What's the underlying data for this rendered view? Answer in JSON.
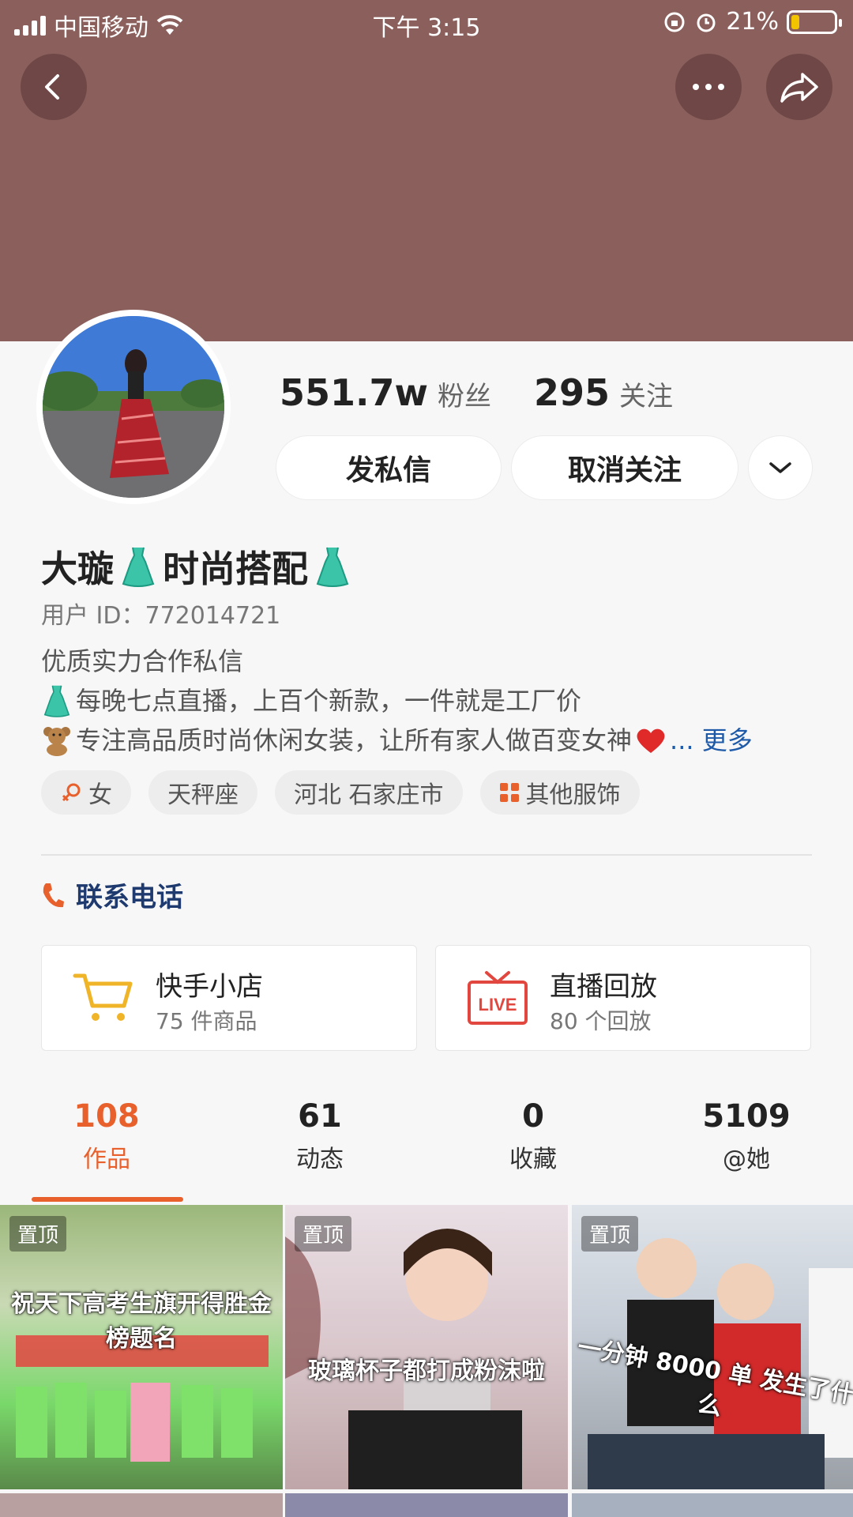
{
  "status_bar": {
    "carrier": "中国移动",
    "time": "下午 3:15",
    "battery": "21%"
  },
  "header": {
    "back_icon": "chevron-left-icon",
    "more_icon": "more-dots-icon",
    "share_icon": "share-icon",
    "cover_color": "#8a5f5c"
  },
  "profile": {
    "followers_count": "551.7w",
    "followers_label": "粉丝",
    "following_count": "295",
    "following_label": "关注",
    "message_button": "发私信",
    "unfollow_button": "取消关注",
    "name_part1": "大璇",
    "name_part2": "时尚搭配",
    "user_id": "用户 ID：772014721",
    "bio_line1": "优质实力合作私信",
    "bio_line2": "每晚七点直播，上百个新款，一件就是工厂价",
    "bio_line3": "专注高品质时尚休闲女装，让所有家人做百变女神",
    "bio_more": "... 更多",
    "tags": [
      "女",
      "天秤座",
      "河北 石家庄市",
      "其他服饰"
    ]
  },
  "contact": {
    "label": "联系电话"
  },
  "cards": [
    {
      "title": "快手小店",
      "subtitle": "75 件商品",
      "icon": "cart-icon"
    },
    {
      "title": "直播回放",
      "subtitle": "80 个回放",
      "icon": "live-tv-icon"
    }
  ],
  "tabs": [
    {
      "count": "108",
      "label": "作品"
    },
    {
      "count": "61",
      "label": "动态"
    },
    {
      "count": "0",
      "label": "收藏"
    },
    {
      "count": "5109",
      "label": "@她"
    }
  ],
  "videos": [
    {
      "pin": "置顶",
      "caption": "祝天下高考生旗开得胜金榜题名"
    },
    {
      "pin": "置顶",
      "caption": "玻璃杯子都打成粉沫啦"
    },
    {
      "pin": "置顶",
      "caption": "一分钟 8000 单 发生了什么"
    }
  ],
  "colors": {
    "accent": "#e8602c",
    "link": "#1e5aa8"
  }
}
